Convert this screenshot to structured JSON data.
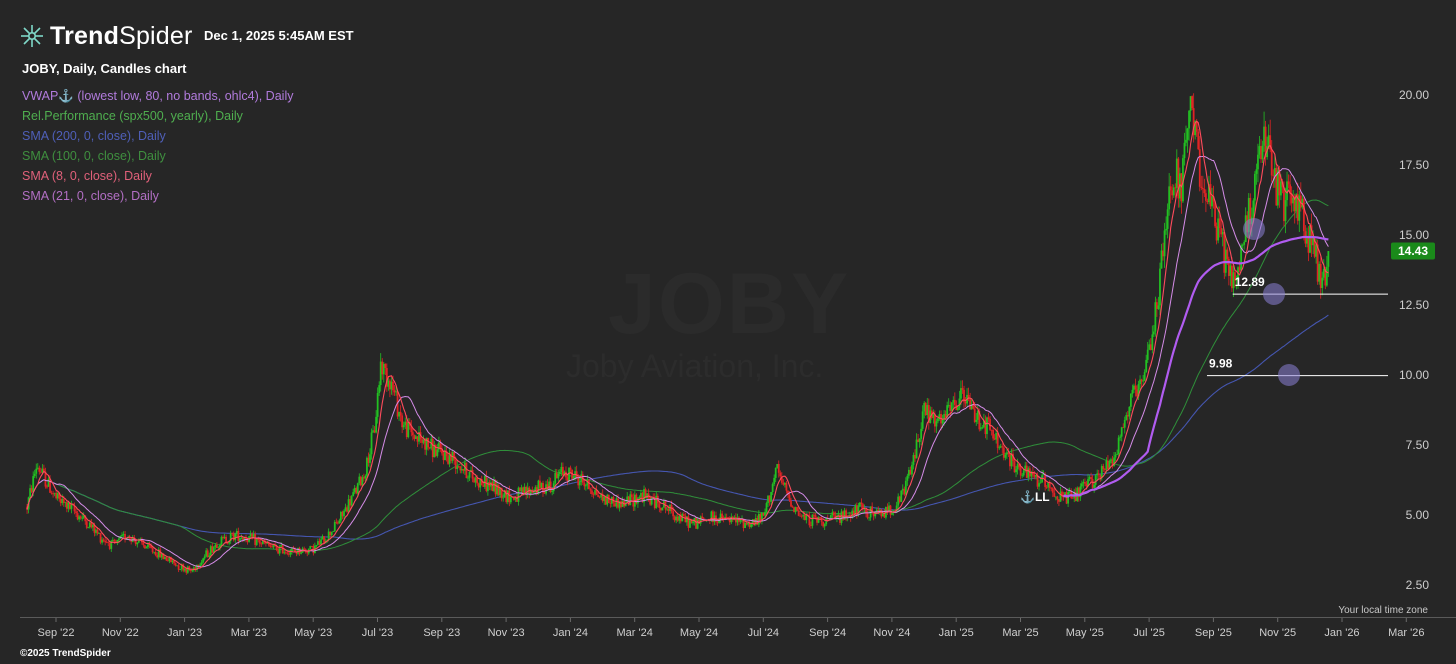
{
  "header": {
    "brand_bold": "Trend",
    "brand_light": "Spider",
    "datetime": "Dec 1, 2025 5:45AM EST"
  },
  "chart_title": "JOBY, Daily, Candles chart",
  "legend": [
    {
      "text": "VWAP⚓ (lowest low, 80, no bands, ohlc4), Daily",
      "color": "#b17bdc"
    },
    {
      "text": "Rel.Performance (spx500, yearly), Daily",
      "color": "#4fae4f"
    },
    {
      "text": "SMA (200, 0, close), Daily",
      "color": "#4f5fb8"
    },
    {
      "text": "SMA (100, 0, close), Daily",
      "color": "#3f8f3f"
    },
    {
      "text": "SMA (8, 0, close), Daily",
      "color": "#e0607a"
    },
    {
      "text": "SMA (21, 0, close), Daily",
      "color": "#b26fc4"
    }
  ],
  "watermark": {
    "ticker": "JOBY",
    "name": "Joby Aviation, Inc."
  },
  "footer": {
    "copyright": "©2025 TrendSpider",
    "tz_note": "Your local time zone"
  },
  "colors": {
    "up": "#22c022",
    "down": "#e02424",
    "sma8": "#ff4b5c",
    "sma21": "#d58ce8",
    "sma100": "#2f8f3a",
    "sma200": "#4556b0",
    "vwap": "#b15cf0",
    "badge": "#1a8a1a"
  },
  "chart_data": {
    "type": "line",
    "title": "JOBY, Daily, Candles chart",
    "ylim": [
      2.2,
      21.2
    ],
    "y_ticks": [
      2.5,
      5.0,
      7.5,
      10.0,
      12.5,
      15.0,
      17.5,
      20.0
    ],
    "y_tick_labels": [
      "2.50",
      "5.00",
      "7.50",
      "10.00",
      "12.50",
      "15.00",
      "17.50",
      "20.00"
    ],
    "x_tick_labels": [
      "Sep '22",
      "Nov '22",
      "Jan '23",
      "Mar '23",
      "May '23",
      "Jul '23",
      "Sep '23",
      "Nov '23",
      "Jan '24",
      "Mar '24",
      "May '24",
      "Jul '24",
      "Sep '24",
      "Nov '24",
      "Jan '25",
      "Mar '25",
      "May '25",
      "Jul '25",
      "Sep '25",
      "Nov '25",
      "Jan '26",
      "Mar '26"
    ],
    "x_tick_months": [
      0,
      2,
      4,
      6,
      8,
      10,
      12,
      14,
      16,
      18,
      20,
      22,
      24,
      26,
      28,
      30,
      32,
      34,
      36,
      38,
      40,
      42
    ],
    "last_price": 14.43,
    "last_price_label": "14.43",
    "horizontal_levels": [
      {
        "value": 12.89,
        "label": "12.89",
        "start_month": 36.6
      },
      {
        "value": 9.98,
        "label": "9.98",
        "start_month": 35.8
      }
    ],
    "anchor_label": "LL",
    "price_path": [
      [
        -0.9,
        5.3
      ],
      [
        -0.6,
        6.8
      ],
      [
        0.0,
        5.6
      ],
      [
        0.5,
        5.2
      ],
      [
        1.0,
        4.7
      ],
      [
        1.4,
        4.2
      ],
      [
        1.8,
        3.9
      ],
      [
        2.2,
        4.3
      ],
      [
        2.6,
        4.0
      ],
      [
        3.2,
        3.6
      ],
      [
        3.8,
        3.2
      ],
      [
        4.2,
        3.0
      ],
      [
        4.6,
        3.5
      ],
      [
        5.0,
        4.0
      ],
      [
        5.6,
        4.3
      ],
      [
        6.2,
        4.1
      ],
      [
        6.8,
        3.8
      ],
      [
        7.4,
        3.7
      ],
      [
        8.0,
        3.8
      ],
      [
        8.4,
        4.2
      ],
      [
        8.8,
        4.8
      ],
      [
        9.2,
        5.6
      ],
      [
        9.6,
        6.5
      ],
      [
        9.9,
        8.0
      ],
      [
        10.1,
        10.4
      ],
      [
        10.4,
        9.8
      ],
      [
        10.8,
        8.2
      ],
      [
        11.2,
        7.8
      ],
      [
        11.8,
        7.3
      ],
      [
        12.4,
        7.0
      ],
      [
        13.0,
        6.3
      ],
      [
        13.6,
        6.0
      ],
      [
        14.2,
        5.6
      ],
      [
        14.8,
        5.9
      ],
      [
        15.4,
        6.1
      ],
      [
        15.8,
        6.6
      ],
      [
        16.4,
        6.2
      ],
      [
        17.0,
        5.6
      ],
      [
        17.6,
        5.4
      ],
      [
        18.2,
        5.7
      ],
      [
        18.8,
        5.4
      ],
      [
        19.4,
        4.9
      ],
      [
        19.8,
        4.7
      ],
      [
        20.4,
        4.9
      ],
      [
        21.0,
        4.8
      ],
      [
        21.6,
        4.7
      ],
      [
        22.0,
        4.9
      ],
      [
        22.4,
        6.6
      ],
      [
        22.8,
        5.6
      ],
      [
        23.2,
        4.9
      ],
      [
        23.8,
        4.8
      ],
      [
        24.4,
        4.9
      ],
      [
        25.0,
        5.2
      ],
      [
        25.6,
        5.0
      ],
      [
        26.2,
        5.4
      ],
      [
        26.6,
        6.6
      ],
      [
        27.0,
        8.8
      ],
      [
        27.4,
        8.2
      ],
      [
        27.8,
        8.7
      ],
      [
        28.2,
        9.3
      ],
      [
        28.6,
        8.6
      ],
      [
        29.0,
        8.1
      ],
      [
        29.6,
        7.0
      ],
      [
        30.2,
        6.4
      ],
      [
        30.8,
        6.2
      ],
      [
        31.2,
        5.6
      ],
      [
        31.6,
        5.6
      ],
      [
        32.0,
        6.0
      ],
      [
        32.6,
        6.6
      ],
      [
        33.0,
        7.4
      ],
      [
        33.4,
        9.0
      ],
      [
        33.8,
        9.6
      ],
      [
        34.1,
        11.5
      ],
      [
        34.4,
        14.0
      ],
      [
        34.7,
        17.2
      ],
      [
        35.0,
        16.8
      ],
      [
        35.3,
        19.3
      ],
      [
        35.6,
        17.4
      ],
      [
        35.9,
        16.0
      ],
      [
        36.2,
        15.0
      ],
      [
        36.5,
        13.4
      ],
      [
        36.8,
        13.8
      ],
      [
        37.0,
        15.2
      ],
      [
        37.3,
        16.9
      ],
      [
        37.6,
        18.4
      ],
      [
        37.9,
        16.9
      ],
      [
        38.2,
        16.1
      ],
      [
        38.5,
        16.4
      ],
      [
        38.8,
        15.6
      ],
      [
        39.1,
        14.5
      ],
      [
        39.4,
        13.2
      ],
      [
        39.6,
        14.3
      ]
    ]
  }
}
